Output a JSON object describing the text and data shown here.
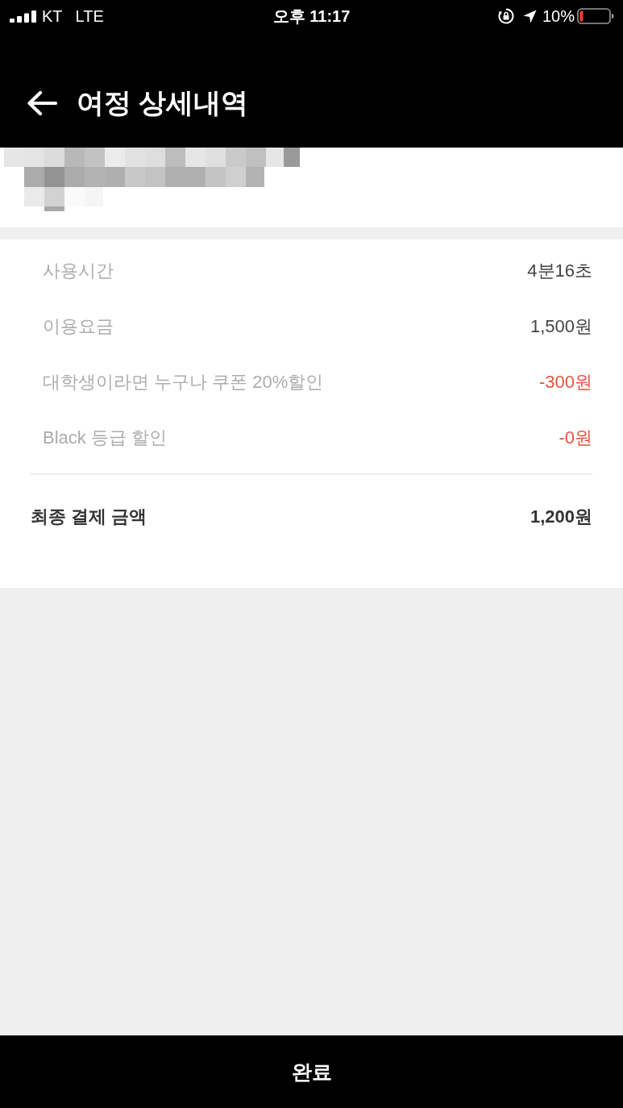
{
  "status_bar": {
    "carrier": "KT",
    "network": "LTE",
    "time": "오후 11:17",
    "battery": "10%"
  },
  "header": {
    "title": "여정 상세내역"
  },
  "details": [
    {
      "label": "사용시간",
      "value": "4분16초",
      "kind": "plain"
    },
    {
      "label": "이용요금",
      "value": "1,500원",
      "kind": "plain"
    },
    {
      "label": "대학생이라면 누구나 쿠폰 20%할인",
      "value": "-300원",
      "kind": "discount"
    },
    {
      "label": "Black 등급 할인",
      "value": "-0원",
      "kind": "discount"
    }
  ],
  "total": {
    "label": "최종 결제 금액",
    "value": "1,200원"
  },
  "footer": {
    "button": "완료"
  }
}
